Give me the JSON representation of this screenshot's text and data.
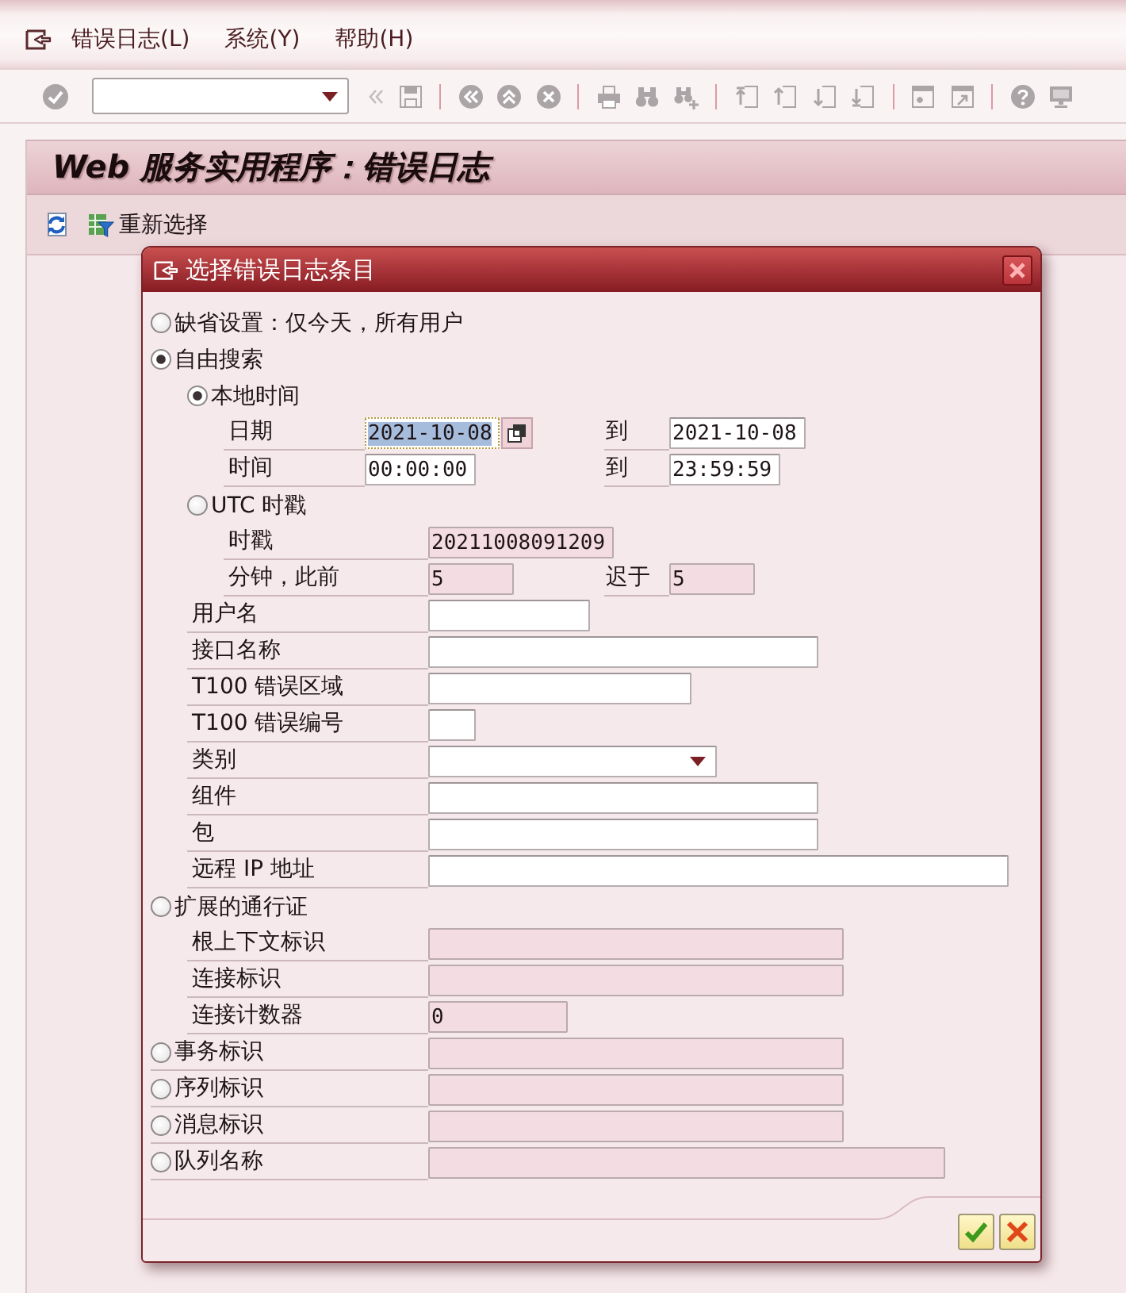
{
  "menu_bar": {
    "items": [
      {
        "label": "错误日志(L)"
      },
      {
        "label": "系统(Y)"
      },
      {
        "label": "帮助(H)"
      }
    ]
  },
  "toolbar": {
    "disabled": true
  },
  "title": "Web 服务实用程序：错误日志",
  "app_toolbar": {
    "reselect_label": "重新选择"
  },
  "dialog": {
    "title": "选择错误日志条目",
    "items": [
      {
        "kind": "radio",
        "label": "缺省设置：仅今天，所有用户",
        "selected": false
      },
      {
        "kind": "radio",
        "label": "自由搜索",
        "selected": true,
        "children": [
          {
            "kind": "radio",
            "label": "本地时间",
            "selected": true,
            "children": [
              {
                "kind": "range",
                "label": "日期",
                "from": {
                  "kind": "input",
                  "value": "2021-10-08",
                  "disabled": false,
                  "focused": true
                },
                "to_label": "到",
                "to": {
                  "kind": "input",
                  "value": "2021-10-08",
                  "disabled": false,
                  "focused": false
                }
              },
              {
                "kind": "range",
                "label": "时间",
                "from": {
                  "kind": "input",
                  "value": "00:00:00",
                  "disabled": false,
                  "focused": false
                },
                "to_label": "到",
                "to": {
                  "kind": "input",
                  "value": "23:59:59",
                  "disabled": false,
                  "focused": false
                }
              }
            ]
          },
          {
            "kind": "radio",
            "label": "UTC 时戳",
            "selected": false,
            "children": [
              {
                "kind": "field",
                "label": "时戳",
                "field": {
                  "kind": "input",
                  "value": "20211008091209",
                  "disabled": true,
                  "focused": false
                }
              },
              {
                "kind": "range",
                "label": "分钟，此前",
                "from": {
                  "kind": "input",
                  "value": "5",
                  "disabled": true,
                  "focused": false
                },
                "to_label": "迟于",
                "to": {
                  "kind": "input",
                  "value": "5",
                  "disabled": true,
                  "focused": false
                }
              }
            ]
          },
          {
            "kind": "field",
            "label": "用户名",
            "field": {
              "kind": "input",
              "disabled": false,
              "focused": false
            }
          },
          {
            "kind": "field",
            "label": "接口名称",
            "field": {
              "kind": "input",
              "disabled": false,
              "focused": false
            }
          },
          {
            "kind": "field",
            "label": "T100 错误区域",
            "field": {
              "kind": "input",
              "disabled": false,
              "focused": false
            }
          },
          {
            "kind": "field",
            "label": "T100 错误编号",
            "field": {
              "kind": "input",
              "disabled": false,
              "focused": false
            }
          },
          {
            "kind": "field",
            "label": "类别",
            "field": {
              "kind": "dropdown",
              "disabled": false,
              "focused": false
            }
          },
          {
            "kind": "field",
            "label": "组件",
            "field": {
              "kind": "input",
              "disabled": false,
              "focused": false
            }
          },
          {
            "kind": "field",
            "label": "包",
            "field": {
              "kind": "input",
              "disabled": false,
              "focused": false
            }
          },
          {
            "kind": "field",
            "label": "远程 IP 地址",
            "field": {
              "kind": "input",
              "disabled": false,
              "focused": false
            }
          }
        ]
      },
      {
        "kind": "radio",
        "label": "扩展的通行证",
        "selected": false,
        "children": [
          {
            "kind": "field",
            "label": "根上下文标识",
            "field": {
              "kind": "input",
              "disabled": true,
              "focused": false
            }
          },
          {
            "kind": "field",
            "label": "连接标识",
            "field": {
              "kind": "input",
              "disabled": true,
              "focused": false
            }
          },
          {
            "kind": "field",
            "label": "连接计数器",
            "field": {
              "kind": "input",
              "value": "0",
              "disabled": true,
              "focused": false
            }
          }
        ]
      },
      {
        "kind": "radio",
        "label": "事务标识",
        "selected": false,
        "field": {
          "kind": "input",
          "disabled": true,
          "focused": false
        }
      },
      {
        "kind": "radio",
        "label": "序列标识",
        "selected": false,
        "field": {
          "kind": "input",
          "disabled": true,
          "focused": false
        }
      },
      {
        "kind": "radio",
        "label": "消息标识",
        "selected": false,
        "field": {
          "kind": "input",
          "disabled": true,
          "focused": false
        }
      },
      {
        "kind": "radio",
        "label": "队列名称",
        "selected": false,
        "field": {
          "kind": "input",
          "disabled": true,
          "focused": false
        }
      }
    ]
  }
}
